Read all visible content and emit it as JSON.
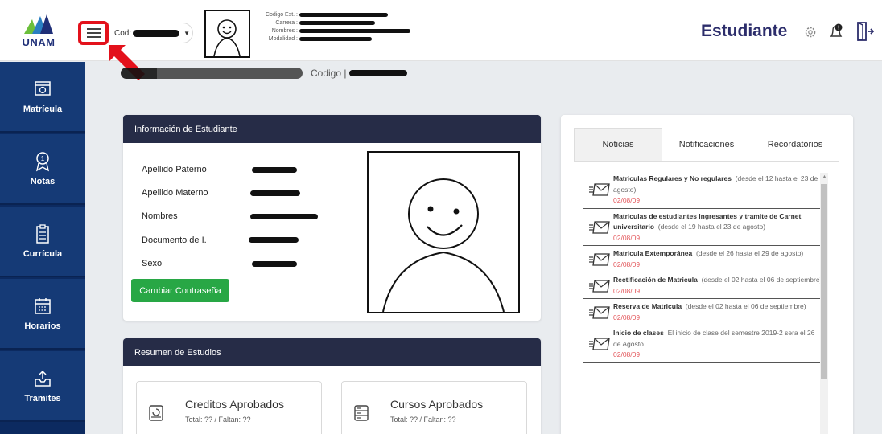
{
  "logo": {
    "text": "UNAM"
  },
  "topbar": {
    "cod_label": "Cod:",
    "info_labels": [
      "Codigo Est. :",
      "Carrera :",
      "Nombres :",
      "Modalidad :"
    ],
    "title": "Estudiante"
  },
  "sidebar": {
    "items": [
      {
        "label": "Matrícula",
        "icon": "register-icon"
      },
      {
        "label": "Notas",
        "icon": "grade-medal-icon"
      },
      {
        "label": "Currícula",
        "icon": "clipboard-icon"
      },
      {
        "label": "Horarios",
        "icon": "calendar-icon"
      },
      {
        "label": "Tramites",
        "icon": "inbox-upload-icon"
      }
    ]
  },
  "main": {
    "codigo_label": "Codigo |",
    "info_card": {
      "title": "Información de Estudiante",
      "fields": [
        "Apellido Paterno",
        "Apellido Materno",
        "Nombres",
        "Documento de I.",
        "Sexo"
      ],
      "button": "Cambiar Contraseña"
    },
    "summary_card": {
      "title": "Resumen de Estudios",
      "stats": [
        {
          "title": "Creditos Aprobados",
          "sub": "Total: ?? / Faltan: ??"
        },
        {
          "title": "Cursos Aprobados",
          "sub": "Total: ?? / Faltan: ??"
        }
      ]
    },
    "news_card": {
      "tabs": [
        "Noticias",
        "Notificaciones",
        "Recordatorios"
      ],
      "items": [
        {
          "title": "Matriculas Regulares y No regulares",
          "body": "(desde el 12 hasta el 23 de agosto)",
          "date": "02/08/09"
        },
        {
          "title": "Matriculas de estudiantes Ingresantes y tramite de Carnet universitario",
          "body": "(desde el 19 hasta el 23 de agosto)",
          "date": "02/08/09"
        },
        {
          "title": "Matricula Extemporánea",
          "body": "(desde el 26 hasta el 29 de agosto)",
          "date": "02/08/09"
        },
        {
          "title": "Rectificación de Matricula",
          "body": "(desde el 02 hasta el 06 de septiembre)",
          "date": "02/08/09"
        },
        {
          "title": "Reserva de Matricula",
          "body": "(desde el 02 hasta el 06 de septiembre)",
          "date": "02/08/09"
        },
        {
          "title": "Inicio de clases",
          "body": "El inicio de clase del semestre 2019-2 sera el 26 de Agosto",
          "date": "02/08/09"
        }
      ]
    }
  },
  "colors": {
    "sidebar": "#153a76",
    "header_dark": "#262c47",
    "accent_green": "#28a745",
    "highlight_red": "#e3111b",
    "date_red": "#e3565a"
  }
}
